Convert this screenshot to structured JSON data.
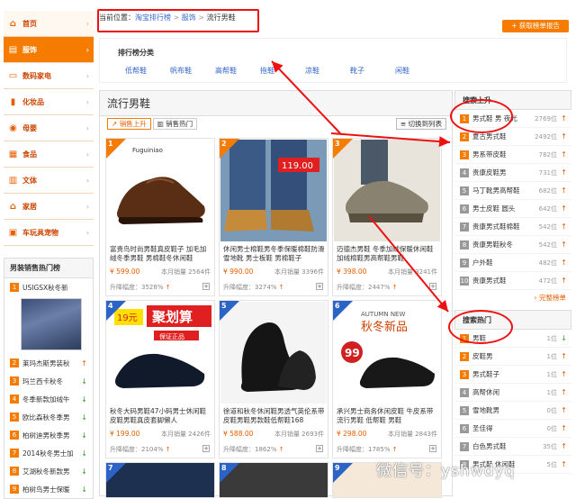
{
  "sidebar": {
    "items": [
      {
        "label": "首页",
        "icon": "home-icon"
      },
      {
        "label": "服饰",
        "icon": "shirt-icon"
      },
      {
        "label": "数码家电",
        "icon": "laptop-icon"
      },
      {
        "label": "化妆品",
        "icon": "cosmetics-icon"
      },
      {
        "label": "母婴",
        "icon": "baby-icon"
      },
      {
        "label": "食品",
        "icon": "food-icon"
      },
      {
        "label": "文体",
        "icon": "book-icon"
      },
      {
        "label": "家居",
        "icon": "house-icon"
      },
      {
        "label": "车玩具宠物",
        "icon": "car-icon"
      }
    ]
  },
  "hot_brands": {
    "title": "男装销售热门榜",
    "top": {
      "num": "1",
      "label": "USIGSX秋冬新"
    },
    "items": [
      {
        "num": "2",
        "label": "莱玛杰斯男装秋",
        "trend": "up"
      },
      {
        "num": "3",
        "label": "玛兰西卡秋冬",
        "trend": "down"
      },
      {
        "num": "4",
        "label": "冬季新款加绒牛",
        "trend": "down"
      },
      {
        "num": "5",
        "label": "欧比森秋冬季男",
        "trend": "down"
      },
      {
        "num": "6",
        "label": "柏树迪男秋季男",
        "trend": "down"
      },
      {
        "num": "7",
        "label": "2014秋冬男士加",
        "trend": "down"
      },
      {
        "num": "8",
        "label": "艾湖秋冬新款男",
        "trend": "down"
      },
      {
        "num": "9",
        "label": "柏树鸟男士保暖",
        "trend": "down"
      }
    ]
  },
  "breadcrumb": {
    "prefix": "当前位置：",
    "c1": "淘宝排行榜",
    "c2": "服饰",
    "c3": "流行男鞋",
    "sep": ">"
  },
  "top_button": "获取榜单报告",
  "category": {
    "title": "排行榜分类",
    "links": [
      "低帮鞋",
      "帆布鞋",
      "高帮鞋",
      "拖鞋",
      "凉鞋",
      "靴子",
      "闲鞋"
    ]
  },
  "main": {
    "title": "流行男鞋",
    "tab1": "销售上升",
    "tab2": "销售热门",
    "switch": "切换到列表",
    "products": [
      {
        "num": "1",
        "name": "富贵鸟时尚男鞋真皮鞋子 加毛加绒冬季男鞋 男棉鞋冬休闲鞋",
        "price": "¥ 599.00",
        "sold": "本月销量 2564件",
        "rise": "升降幅度：3528%",
        "img": "brown-shoe"
      },
      {
        "num": "2",
        "name": "休闲男士棉鞋男冬季保暖棉鞋防滑雪地靴 男士板鞋 男棉鞋子",
        "price": "¥ 990.00",
        "sold": "本月销量 3396件",
        "rise": "升降幅度：3274%",
        "img": "jeans-boots"
      },
      {
        "num": "3",
        "name": "迈德杰男鞋 冬季加绒保暖休闲鞋加绒棉鞋男高帮鞋男鞋",
        "price": "¥ 398.00",
        "sold": "本月销量 3241件",
        "rise": "升降幅度：2447%",
        "img": "grey-shoe"
      },
      {
        "num": "4",
        "name": "秋冬大码男鞋47小码男士休闲鞋皮鞋男鞋真皮套脚懒人",
        "price": "¥ 199.00",
        "sold": "本月销量 2426件",
        "rise": "升降幅度：2104%",
        "img": "promo-shoe"
      },
      {
        "num": "5",
        "name": "徐道和秋冬休闲鞋男透气英伦系带皮鞋男鞋男款鞋低帮鞋168",
        "price": "¥ 588.00",
        "sold": "本月销量 2693件",
        "rise": "升降幅度：1862%",
        "img": "black-shoe"
      },
      {
        "num": "6",
        "name": "承兴男士商务休闲皮鞋 牛皮系带流行男鞋 低帮鞋 男鞋",
        "price": "¥ 298.00",
        "sold": "本月销量 2843件",
        "rise": "升降幅度：1785%",
        "img": "autumn-shoe"
      }
    ],
    "promo_text": "聚划算",
    "promo_price": "19元",
    "promo_sub": "保证正品",
    "autumn_text": "秋冬新品",
    "autumn_en": "AUTUMN NEW",
    "badge99": "99",
    "img2_price": "119.00"
  },
  "rank_up": {
    "title": "搜索上升",
    "items": [
      {
        "num": "1",
        "label": "男式鞋 男 夜光",
        "value": "2769位",
        "trend": "up"
      },
      {
        "num": "2",
        "label": "夏古男式鞋",
        "value": "2492位",
        "trend": "up"
      },
      {
        "num": "3",
        "label": "男系带皮鞋",
        "value": "782位",
        "trend": "up"
      },
      {
        "num": "4",
        "label": "贵康皮鞋男",
        "value": "731位",
        "trend": "up"
      },
      {
        "num": "5",
        "label": "马丁靴男高帮鞋",
        "value": "682位",
        "trend": "up"
      },
      {
        "num": "6",
        "label": "男士皮鞋 圆头",
        "value": "642位",
        "trend": "up"
      },
      {
        "num": "7",
        "label": "贵康男式鞋棉鞋",
        "value": "542位",
        "trend": "up"
      },
      {
        "num": "8",
        "label": "贵康男鞋秋冬",
        "value": "542位",
        "trend": "up"
      },
      {
        "num": "9",
        "label": "户外鞋",
        "value": "482位",
        "trend": "up"
      },
      {
        "num": "10",
        "label": "贵康男式鞋",
        "value": "472位",
        "trend": "up"
      }
    ],
    "more": "完整榜单"
  },
  "rank_hot": {
    "title": "搜索热门",
    "items": [
      {
        "num": "1",
        "label": "男鞋",
        "value": "1位",
        "trend": "down"
      },
      {
        "num": "2",
        "label": "皮鞋男",
        "value": "1位",
        "trend": "up"
      },
      {
        "num": "3",
        "label": "男式鞋子",
        "value": "1位",
        "trend": "up"
      },
      {
        "num": "4",
        "label": "高帮休闲",
        "value": "1位",
        "trend": "up"
      },
      {
        "num": "5",
        "label": "雪地靴男",
        "value": "0位",
        "trend": "up"
      },
      {
        "num": "6",
        "label": "圣佳得",
        "value": "0位",
        "trend": "up"
      },
      {
        "num": "7",
        "label": "白色男式鞋",
        "value": "35位",
        "trend": "up"
      },
      {
        "num": "8",
        "label": "男式鞋 休闲鞋",
        "value": "5位",
        "trend": "up"
      }
    ]
  },
  "watermark": "微信号：yshwdyq",
  "colors": {
    "accent": "#f57c00",
    "annotation": "#ee1111",
    "link": "#3366cc"
  }
}
